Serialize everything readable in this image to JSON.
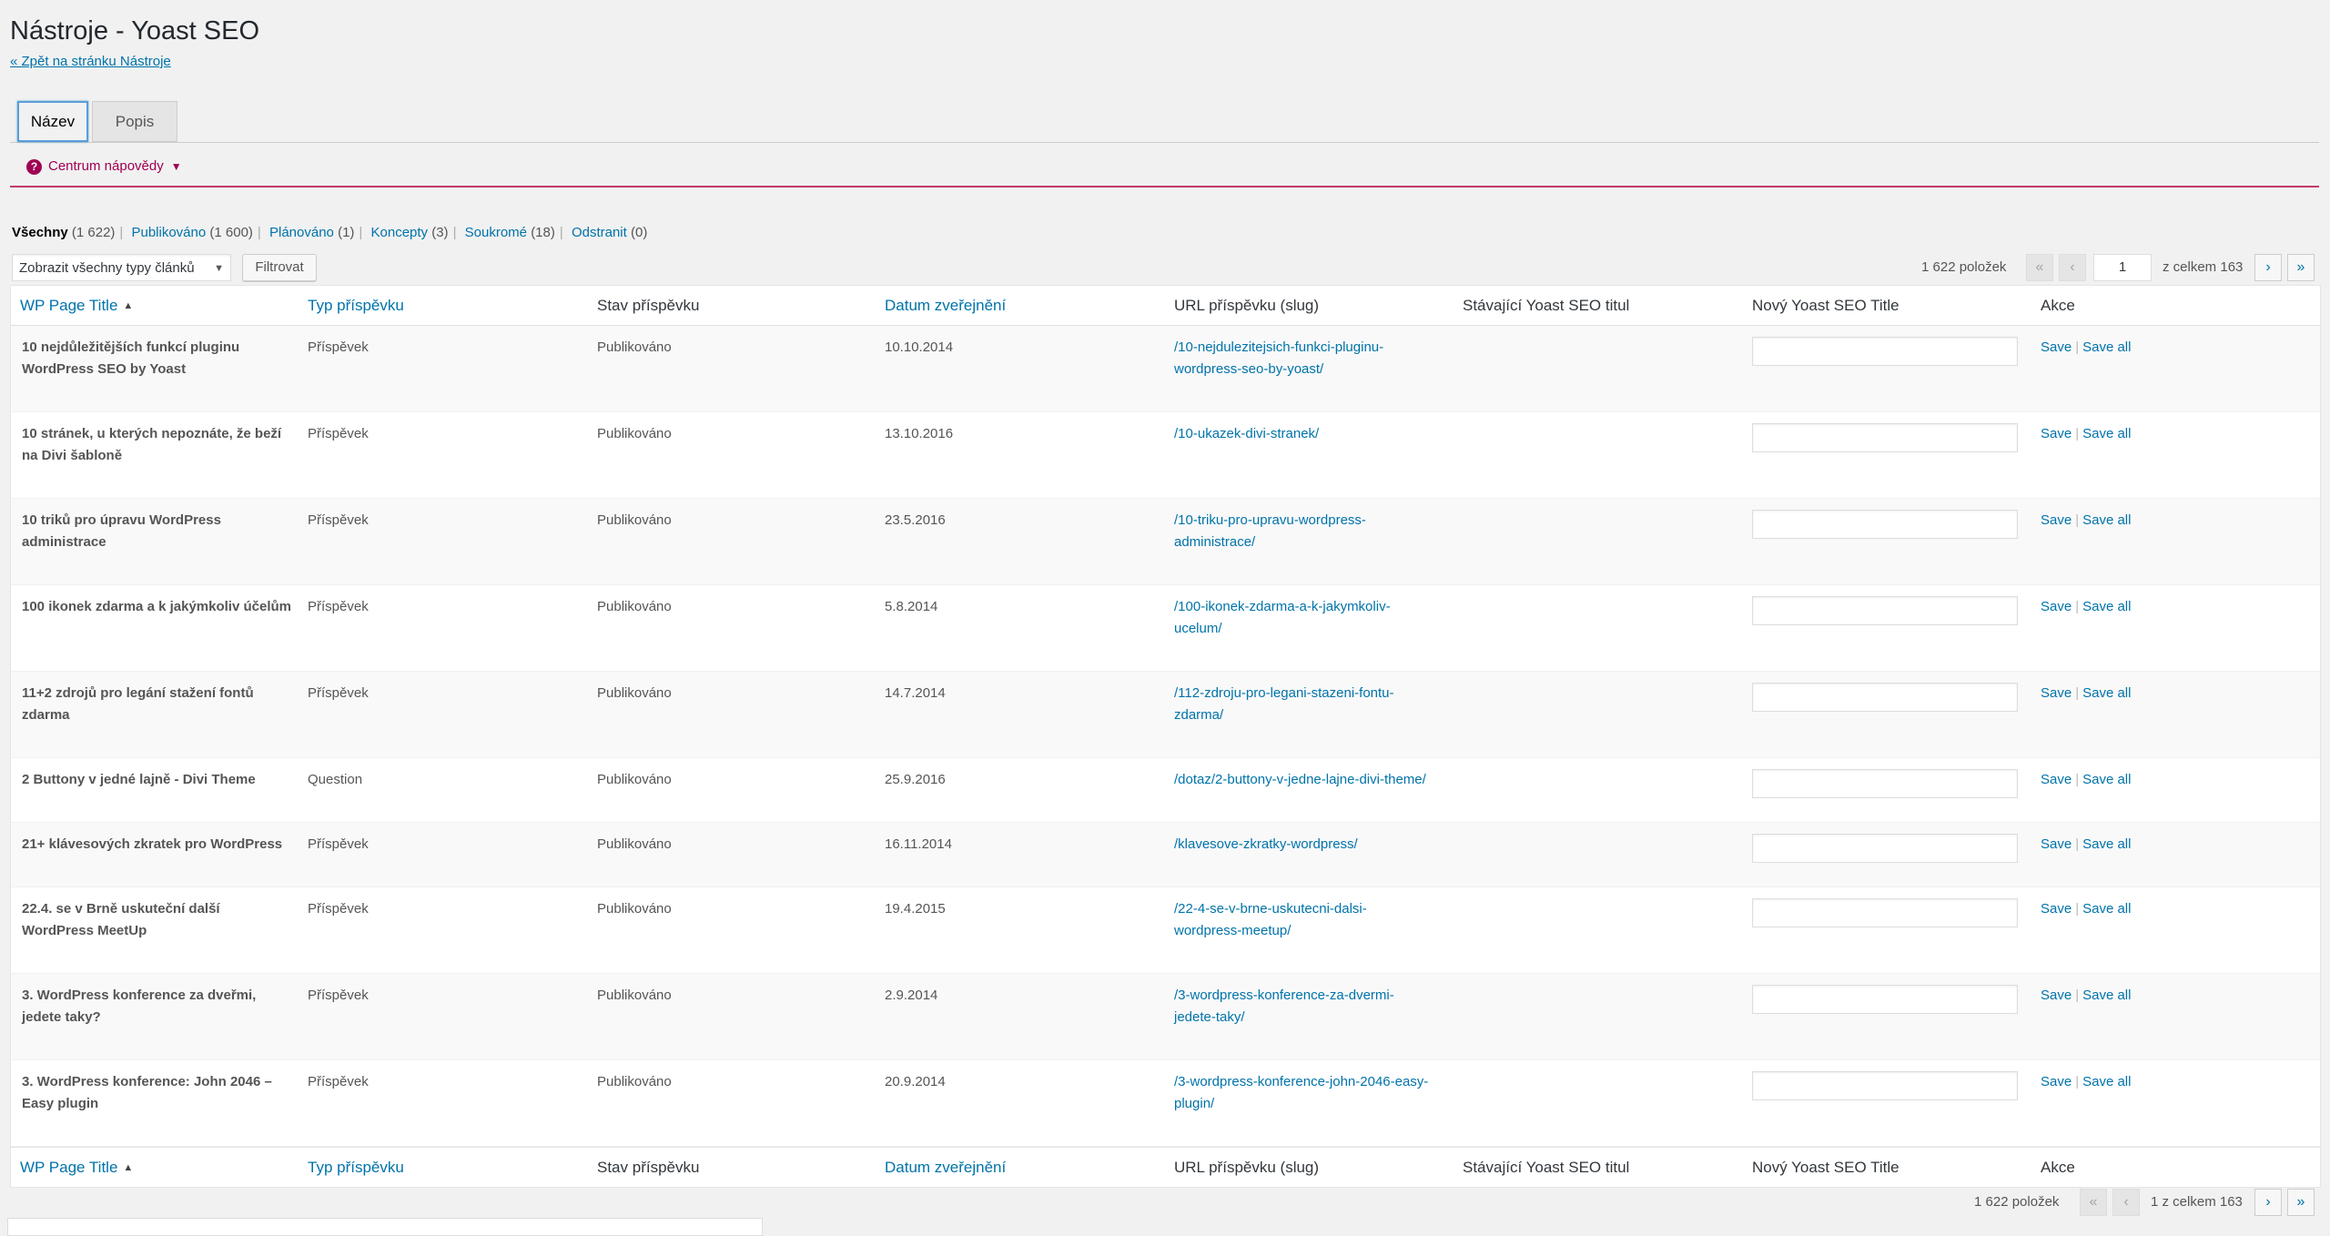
{
  "page": {
    "title": "Nástroje - Yoast SEO",
    "back_link": "« Zpět na stránku Nástroje"
  },
  "tabs": [
    {
      "label": "Název",
      "active": true
    },
    {
      "label": "Popis",
      "active": false
    }
  ],
  "help": {
    "label": "Centrum nápovědy",
    "icon": "question-icon",
    "caret": "▼"
  },
  "views": [
    {
      "label": "Všechny",
      "count": "(1 622)",
      "current": true
    },
    {
      "label": "Publikováno",
      "count": "(1 600)",
      "current": false
    },
    {
      "label": "Plánováno",
      "count": "(1)",
      "current": false
    },
    {
      "label": "Koncepty",
      "count": "(3)",
      "current": false
    },
    {
      "label": "Soukromé",
      "count": "(18)",
      "current": false
    },
    {
      "label": "Odstranit",
      "count": "(0)",
      "current": false
    }
  ],
  "filter": {
    "select_value": "Zobrazit všechny typy článků",
    "button_label": "Filtrovat"
  },
  "pagination_top": {
    "items": "1 622 položek",
    "first": "«",
    "prev": "‹",
    "current_page": "1",
    "total": "z celkem 163",
    "next": "›",
    "last": "»"
  },
  "pagination_bottom": {
    "items": "1 622 položek",
    "first": "«",
    "prev": "‹",
    "page_text": "1 z celkem 163",
    "next": "›",
    "last": "»"
  },
  "columns": {
    "title": "WP Page Title",
    "type": "Typ příspěvku",
    "status": "Stav příspěvku",
    "date": "Datum zveřejnění",
    "url": "URL příspěvku (slug)",
    "current_seo": "Stávající Yoast SEO titul",
    "new_seo": "Nový Yoast SEO Title",
    "actions": "Akce",
    "sort_arrow": "▲"
  },
  "action_labels": {
    "save": "Save",
    "save_all": "Save all"
  },
  "rows": [
    {
      "title": "10 nejdůležitějších funkcí pluginu WordPress SEO by Yoast",
      "type": "Příspěvek",
      "status": "Publikováno",
      "date": "10.10.2014",
      "url": "/10-nejdulezitejsich-funkci-pluginu-wordpress-seo-by-yoast/",
      "current_seo": "",
      "new_seo": ""
    },
    {
      "title": "10 stránek, u kterých nepoznáte, že beží na Divi šabloně",
      "type": "Příspěvek",
      "status": "Publikováno",
      "date": "13.10.2016",
      "url": "/10-ukazek-divi-stranek/",
      "current_seo": "",
      "new_seo": ""
    },
    {
      "title": "10 triků pro úpravu WordPress administrace",
      "type": "Příspěvek",
      "status": "Publikováno",
      "date": "23.5.2016",
      "url": "/10-triku-pro-upravu-wordpress-administrace/",
      "current_seo": "",
      "new_seo": ""
    },
    {
      "title": "100 ikonek zdarma a k jakýmkoliv účelům",
      "type": "Příspěvek",
      "status": "Publikováno",
      "date": "5.8.2014",
      "url": "/100-ikonek-zdarma-a-k-jakymkoliv-ucelum/",
      "current_seo": "",
      "new_seo": ""
    },
    {
      "title": "11+2 zdrojů pro legání stažení fontů zdarma",
      "type": "Příspěvek",
      "status": "Publikováno",
      "date": "14.7.2014",
      "url": "/112-zdroju-pro-legani-stazeni-fontu-zdarma/",
      "current_seo": "",
      "new_seo": ""
    },
    {
      "title": "2 Buttony v jedné lajně - Divi Theme",
      "type": "Question",
      "status": "Publikováno",
      "date": "25.9.2016",
      "url": "/dotaz/2-buttony-v-jedne-lajne-divi-theme/",
      "current_seo": "",
      "new_seo": ""
    },
    {
      "title": "21+ klávesových zkratek pro WordPress",
      "type": "Příspěvek",
      "status": "Publikováno",
      "date": "16.11.2014",
      "url": "/klavesove-zkratky-wordpress/",
      "current_seo": "",
      "new_seo": ""
    },
    {
      "title": "22.4. se v Brně uskuteční další WordPress MeetUp",
      "type": "Příspěvek",
      "status": "Publikováno",
      "date": "19.4.2015",
      "url": "/22-4-se-v-brne-uskutecni-dalsi-wordpress-meetup/",
      "current_seo": "",
      "new_seo": ""
    },
    {
      "title": "3. WordPress konference za dveřmi, jedete taky?",
      "type": "Příspěvek",
      "status": "Publikováno",
      "date": "2.9.2014",
      "url": "/3-wordpress-konference-za-dvermi-jedete-taky/",
      "current_seo": "",
      "new_seo": ""
    },
    {
      "title": "3. WordPress konference: John 2046 – Easy plugin",
      "type": "Příspěvek",
      "status": "Publikováno",
      "date": "20.9.2014",
      "url": "/3-wordpress-konference-john-2046-easy-plugin/",
      "current_seo": "",
      "new_seo": ""
    }
  ]
}
